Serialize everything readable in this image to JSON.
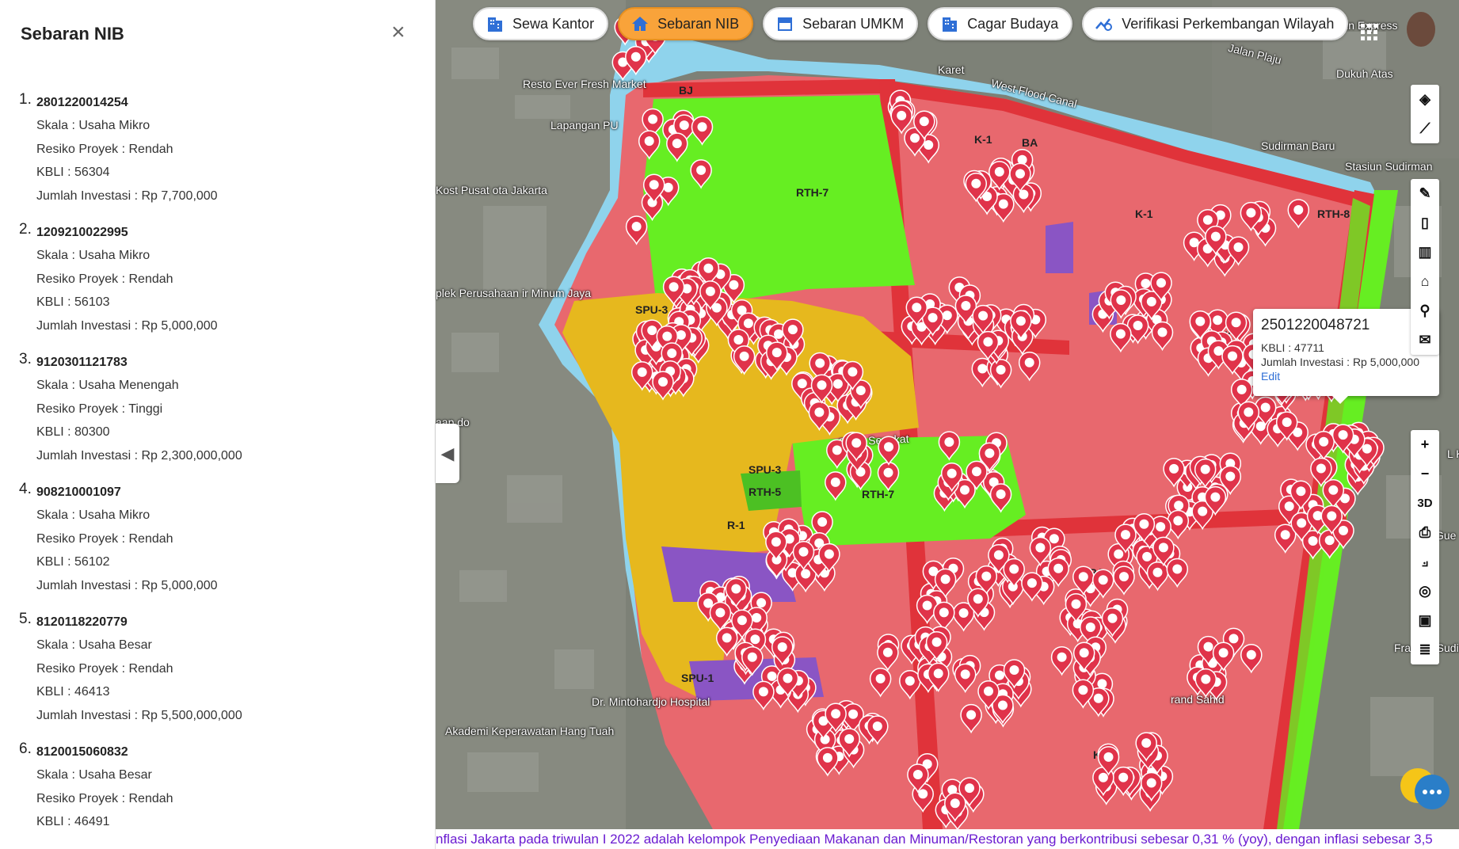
{
  "panel": {
    "title": "Sebaran NIB",
    "close": "×",
    "labels": {
      "scale": "Skala : ",
      "risk": "Resiko Proyek : ",
      "kbli": "KBLI : ",
      "investment": "Jumlah Investasi : "
    },
    "items": [
      {
        "num": "1.",
        "id": "2801220014254",
        "scale": "Usaha Mikro",
        "risk": "Rendah",
        "kbli": "56304",
        "investment": "Rp 7,700,000"
      },
      {
        "num": "2.",
        "id": "1209210022995",
        "scale": "Usaha Mikro",
        "risk": "Rendah",
        "kbli": "56103",
        "investment": "Rp 5,000,000"
      },
      {
        "num": "3.",
        "id": "9120301121783",
        "scale": "Usaha Menengah",
        "risk": "Tinggi",
        "kbli": "80300",
        "investment": "Rp 2,300,000,000"
      },
      {
        "num": "4.",
        "id": "908210001097",
        "scale": "Usaha Mikro",
        "risk": "Rendah",
        "kbli": "56102",
        "investment": "Rp 5,000,000"
      },
      {
        "num": "5.",
        "id": "8120118220779",
        "scale": "Usaha Besar",
        "risk": "Rendah",
        "kbli": "46413",
        "investment": "Rp 5,500,000,000"
      },
      {
        "num": "6.",
        "id": "8120015060832",
        "scale": "Usaha Besar",
        "risk": "Rendah",
        "kbli": "46491",
        "investment": ""
      }
    ]
  },
  "tabs": [
    {
      "label": "Sewa Kantor",
      "icon": "building-icon",
      "active": false
    },
    {
      "label": "Sebaran NIB",
      "icon": "home-icon",
      "active": true
    },
    {
      "label": "Sebaran UMKM",
      "icon": "store-icon",
      "active": false
    },
    {
      "label": "Cagar Budaya",
      "icon": "building-icon",
      "active": false
    },
    {
      "label": "Verifikasi Perkembangan Wilayah",
      "icon": "chart-search-icon",
      "active": false
    }
  ],
  "popup": {
    "title": "2501220048721",
    "kbli": "KBLI : 47711",
    "investment": "Jumlah Investasi : Rp 5,000,000",
    "edit": "Edit",
    "close": "×"
  },
  "map_labels": {
    "resto": "Resto Ever Fresh Market",
    "lapangan": "Lapangan PU",
    "kost": "Kost Pusat ota Jakarta",
    "perusahaan": "plek Perusahaan ir Minum Jaya",
    "karet": "Karet",
    "westflood": "West Flood Canal",
    "jalanplaju": "Jalan Plaju",
    "holiday": "Holiday Inn Express",
    "dukuh": "Dukuh Atas",
    "sudirmanbaru": "Sudirman Baru",
    "stasiun": "Stasiun Sudirman",
    "gang": "Gang Sepakat",
    "hospital": "Dr. Mintohardjo Hospital",
    "akademi": "Akademi Keperawatan Hang Tuah",
    "sahid": "rand Sahid",
    "gue": "Gue",
    "fra": "Fra esic Sudirma",
    "la": "L Ka",
    "nap": "aap do"
  },
  "zones": {
    "rth7a": "RTH-7",
    "rth7b": "RTH-7",
    "rth8": "RTH-8",
    "rth5": "RTH-5",
    "k1": "K-1",
    "r1": "R-1",
    "spu3": "SPU-3",
    "spu1": "SPU-1",
    "bj": "BJ",
    "ba": "BA"
  },
  "toolbar": {
    "zoom_in": "+",
    "zoom_out": "−",
    "three_d": "3D"
  },
  "ticker": "nflasi Jakarta pada triwulan I 2022 adalah kelompok Penyediaan Makanan dan Minuman/Restoran yang berkontribusi sebesar 0,31 % (yoy), dengan inflasi sebesar 3,5",
  "colors": {
    "commercial": "#e8686e",
    "green": "#66ee22",
    "residential": "#e6b81e",
    "public": "#8a55c4",
    "road": "#e0333a",
    "canal": "#8fd3ec",
    "marker": "#e0334a",
    "accent_tab": "#f9a33a",
    "ticker": "#6a1bd1"
  }
}
